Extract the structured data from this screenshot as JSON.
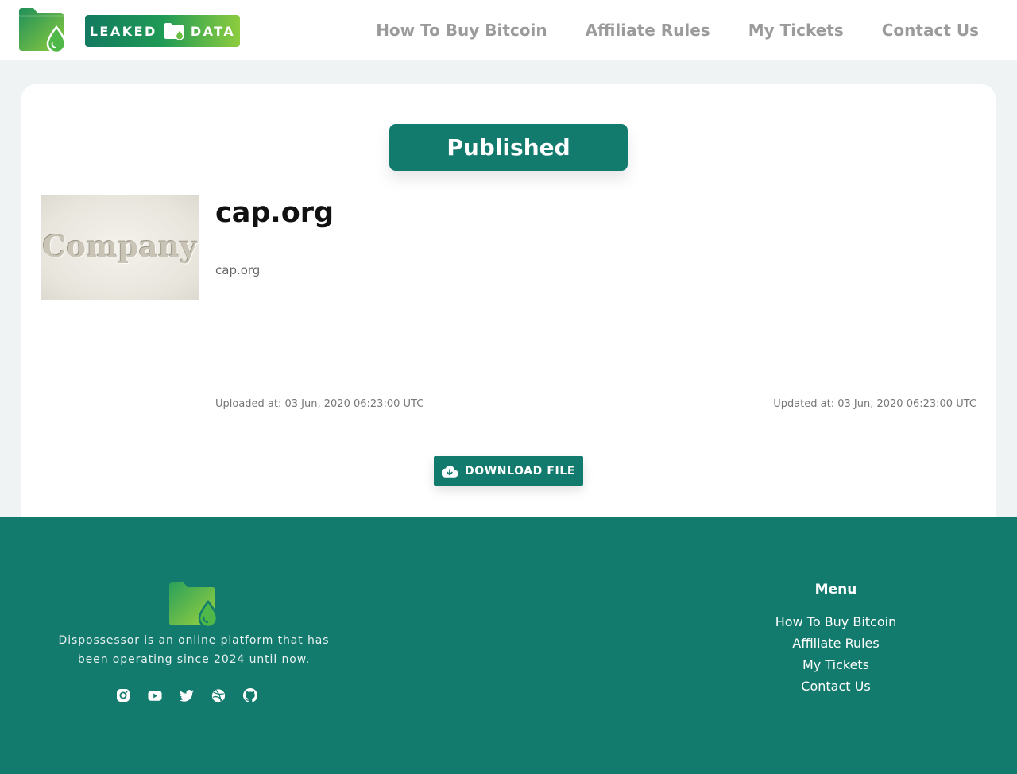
{
  "brand": {
    "badge_left": "LEAKED",
    "badge_right": "DATA"
  },
  "colors": {
    "primary": "#137a6e",
    "nav_text": "#9b9b9b",
    "page_bg": "#f0f3f4",
    "logo_green_light": "#8dcc3e"
  },
  "nav": {
    "items": [
      {
        "label": "How To Buy Bitcoin"
      },
      {
        "label": "Affiliate Rules"
      },
      {
        "label": "My Tickets"
      },
      {
        "label": "Contact Us"
      }
    ]
  },
  "listing": {
    "status": "Published",
    "thumbnail_text": "Company",
    "title": "cap.org",
    "description": "cap.org",
    "uploaded": "Uploaded at: 03 Jun, 2020 06:23:00 UTC",
    "updated": "Updated at: 03 Jun, 2020 06:23:00 UTC",
    "download_label": "DOWNLOAD FILE",
    "download_icon": "cloud-download-icon"
  },
  "footer": {
    "description": "Dispossessor is an online platform that has been operating since 2024 until now.",
    "socials": [
      "instagram-icon",
      "youtube-icon",
      "twitter-icon",
      "dribbble-icon",
      "github-icon"
    ],
    "menu_title": "Menu",
    "menu": [
      {
        "label": "How To Buy Bitcoin"
      },
      {
        "label": "Affiliate Rules"
      },
      {
        "label": "My Tickets"
      },
      {
        "label": "Contact Us"
      }
    ]
  }
}
